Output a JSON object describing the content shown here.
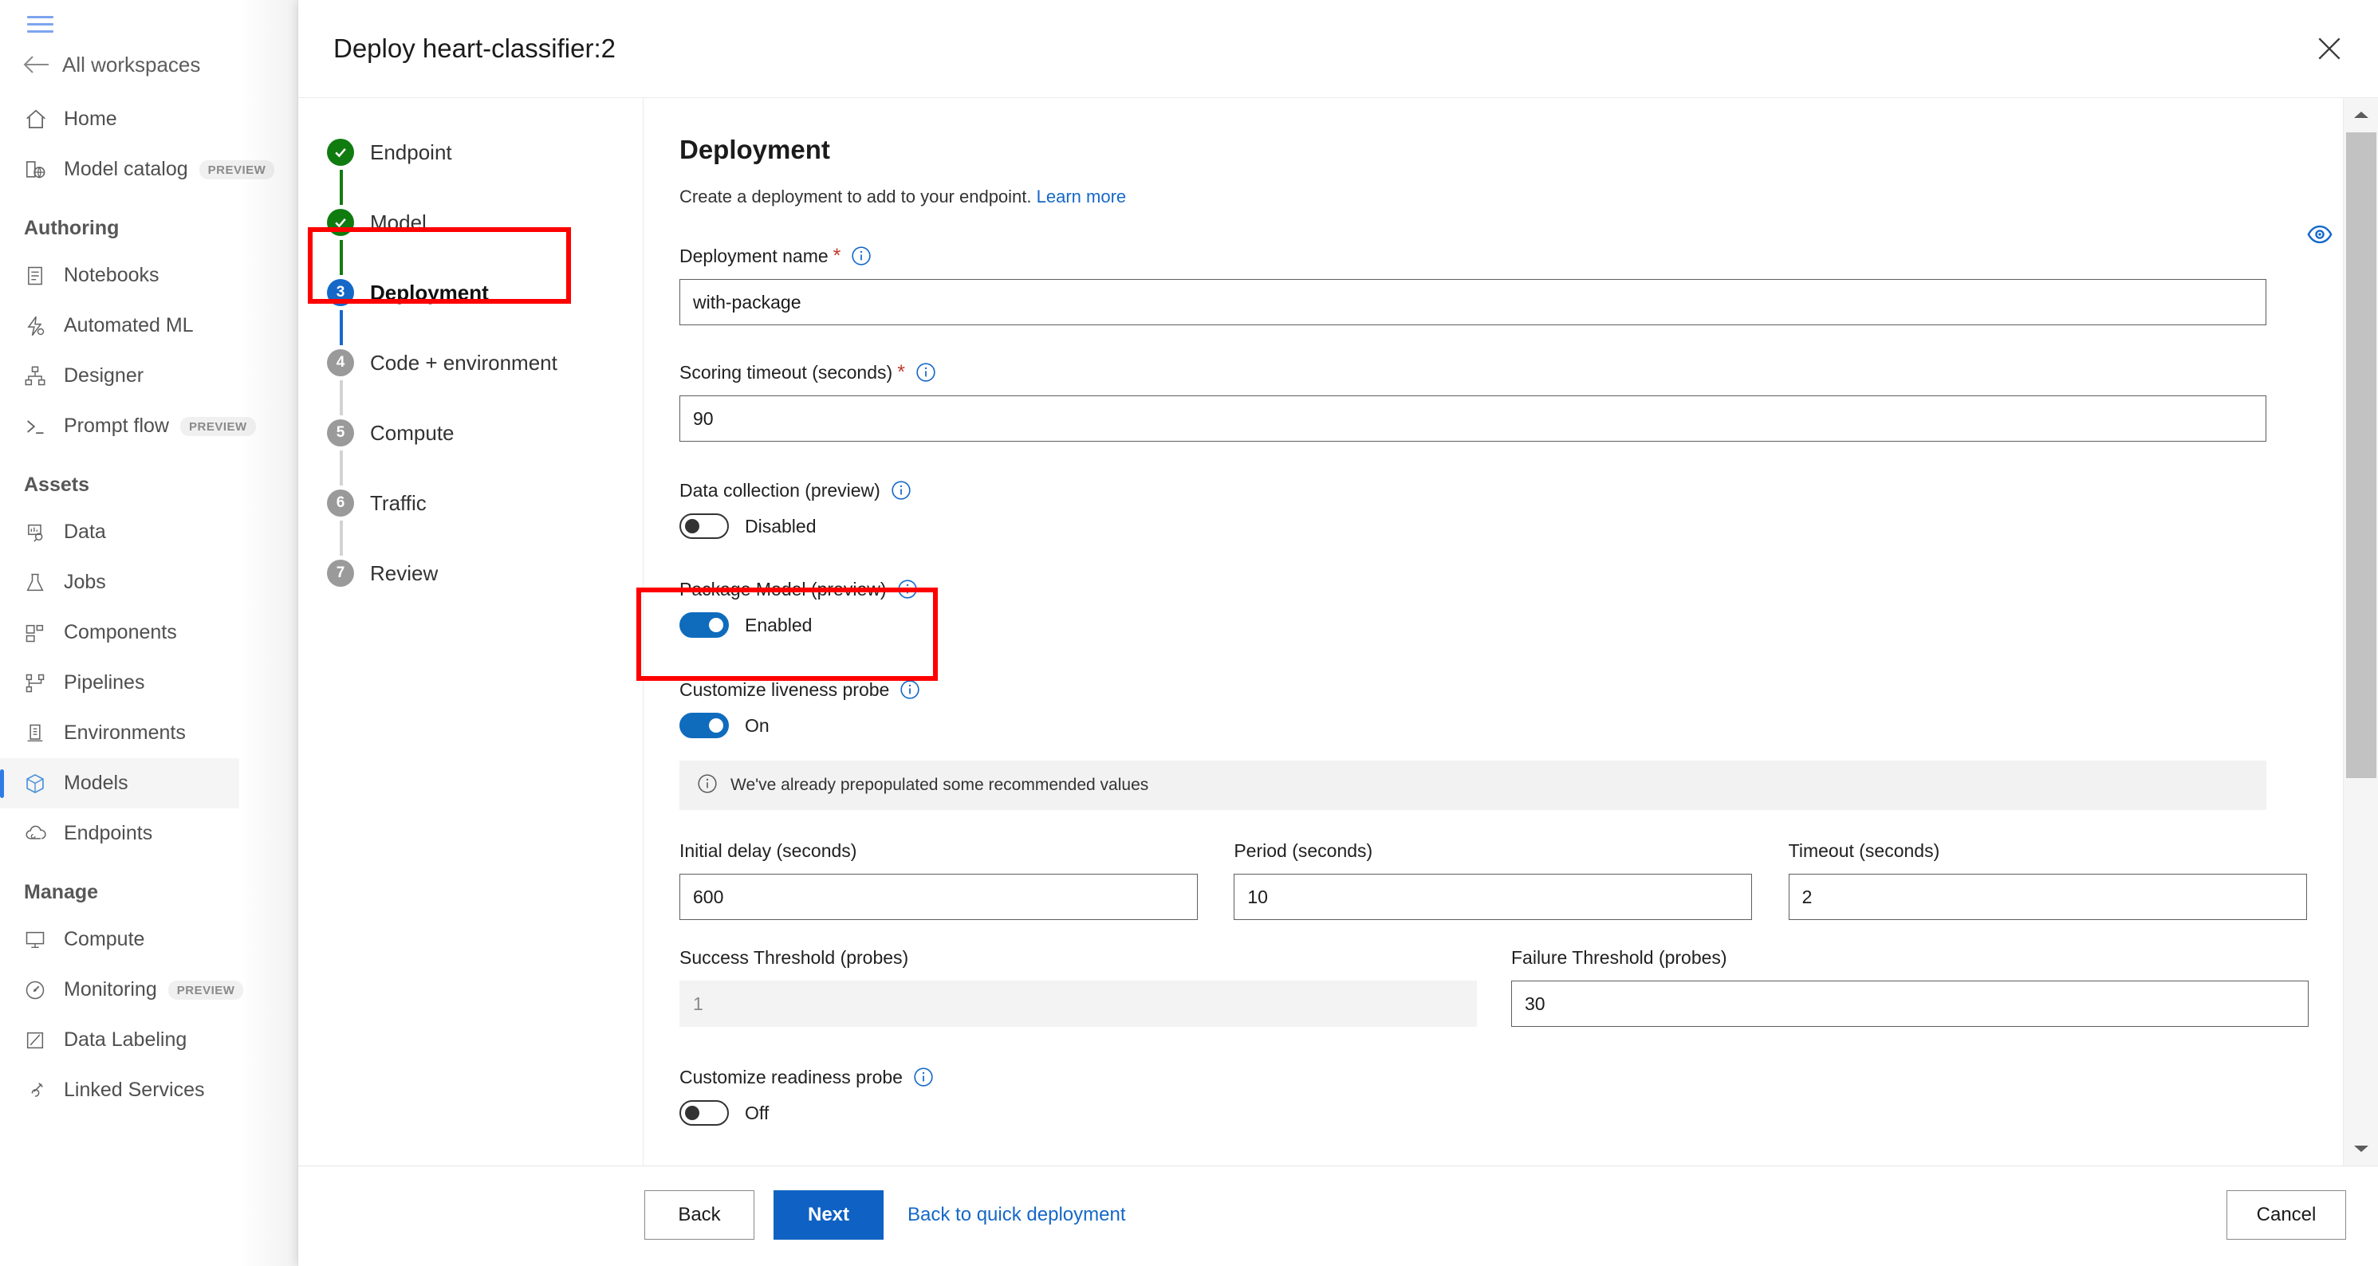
{
  "left_nav": {
    "menu_icon": "hamburger-icon",
    "back_label": "All workspaces",
    "back_icon": "arrow-left-icon",
    "top_items": [
      {
        "label": "Home",
        "icon": "home-icon",
        "badge": "",
        "active": false
      },
      {
        "label": "Model catalog",
        "icon": "model-catalog-icon",
        "badge": "PREVIEW",
        "active": false
      }
    ],
    "groups": [
      {
        "header": "Authoring",
        "items": [
          {
            "label": "Notebooks",
            "icon": "notebook-icon",
            "badge": "",
            "active": false
          },
          {
            "label": "Automated ML",
            "icon": "automated-ml-icon",
            "badge": "",
            "active": false
          },
          {
            "label": "Designer",
            "icon": "designer-icon",
            "badge": "",
            "active": false
          },
          {
            "label": "Prompt flow",
            "icon": "prompt-flow-icon",
            "badge": "PREVIEW",
            "active": false
          }
        ]
      },
      {
        "header": "Assets",
        "items": [
          {
            "label": "Data",
            "icon": "data-icon",
            "badge": "",
            "active": false
          },
          {
            "label": "Jobs",
            "icon": "jobs-icon",
            "badge": "",
            "active": false
          },
          {
            "label": "Components",
            "icon": "components-icon",
            "badge": "",
            "active": false
          },
          {
            "label": "Pipelines",
            "icon": "pipelines-icon",
            "badge": "",
            "active": false
          },
          {
            "label": "Environments",
            "icon": "environments-icon",
            "badge": "",
            "active": false
          },
          {
            "label": "Models",
            "icon": "models-icon",
            "badge": "",
            "active": true
          },
          {
            "label": "Endpoints",
            "icon": "endpoints-icon",
            "badge": "",
            "active": false
          }
        ]
      },
      {
        "header": "Manage",
        "items": [
          {
            "label": "Compute",
            "icon": "compute-icon",
            "badge": "",
            "active": false
          },
          {
            "label": "Monitoring",
            "icon": "monitoring-icon",
            "badge": "PREVIEW",
            "active": false
          },
          {
            "label": "Data Labeling",
            "icon": "data-labeling-icon",
            "badge": "",
            "active": false
          },
          {
            "label": "Linked Services",
            "icon": "linked-services-icon",
            "badge": "",
            "active": false
          }
        ]
      }
    ]
  },
  "panel": {
    "title": "Deploy heart-classifier:2",
    "close_icon": "close-icon"
  },
  "steps": [
    {
      "num": "1",
      "label": "Endpoint",
      "state": "done"
    },
    {
      "num": "2",
      "label": "Model",
      "state": "done"
    },
    {
      "num": "3",
      "label": "Deployment",
      "state": "current"
    },
    {
      "num": "4",
      "label": "Code + environment",
      "state": "todo"
    },
    {
      "num": "5",
      "label": "Compute",
      "state": "todo"
    },
    {
      "num": "6",
      "label": "Traffic",
      "state": "todo"
    },
    {
      "num": "7",
      "label": "Review",
      "state": "todo"
    }
  ],
  "content": {
    "heading": "Deployment",
    "subtext": "Create a deployment to add to your endpoint.",
    "learn_more": "Learn more",
    "reveal_icon": "eye-icon",
    "deployment_name": {
      "label": "Deployment name",
      "required": "*",
      "info_icon": "info-icon",
      "value": "with-package",
      "placeholder": ""
    },
    "scoring_timeout": {
      "label": "Scoring timeout (seconds)",
      "required": "*",
      "info_icon": "info-icon",
      "value": "90",
      "placeholder": ""
    },
    "data_collection": {
      "label": "Data collection (preview)",
      "info_icon": "info-icon",
      "state_label": "Disabled",
      "on": false
    },
    "package_model": {
      "label": "Package Model (preview)",
      "info_icon": "info-icon",
      "state_label": "Enabled",
      "on": true
    },
    "liveness_probe": {
      "label": "Customize liveness probe",
      "info_icon": "info-icon",
      "state_label": "On",
      "on": true
    },
    "info_bar": {
      "icon": "info-circle-icon",
      "text": "We've already prepopulated some recommended values"
    },
    "probe_fields": {
      "initial_delay": {
        "label": "Initial delay (seconds)",
        "value": "600"
      },
      "period": {
        "label": "Period (seconds)",
        "value": "10"
      },
      "timeout": {
        "label": "Timeout (seconds)",
        "value": "2"
      },
      "success_threshold": {
        "label": "Success Threshold (probes)",
        "value": "1",
        "readonly": true
      },
      "failure_threshold": {
        "label": "Failure Threshold (probes)",
        "value": "30",
        "readonly": false
      }
    },
    "readiness_probe": {
      "label": "Customize readiness probe",
      "info_icon": "info-icon",
      "state_label": "Off",
      "on": false
    }
  },
  "footer": {
    "back": "Back",
    "next": "Next",
    "quick_link": "Back to quick deployment",
    "cancel": "Cancel"
  },
  "scrollbar": {
    "up_icon": "scroll-up-arrow-icon",
    "down_icon": "scroll-down-arrow-icon",
    "thumb": "scroll-thumb"
  },
  "colors": {
    "accent": "#0f62c4",
    "link": "#1668c8",
    "toggle_on": "#0f6cbd",
    "step_done": "#107c10",
    "step_current": "#1668c8",
    "step_todo": "#9a9a9a",
    "highlight_box": "#fe0000",
    "required_star": "#c0392b"
  }
}
